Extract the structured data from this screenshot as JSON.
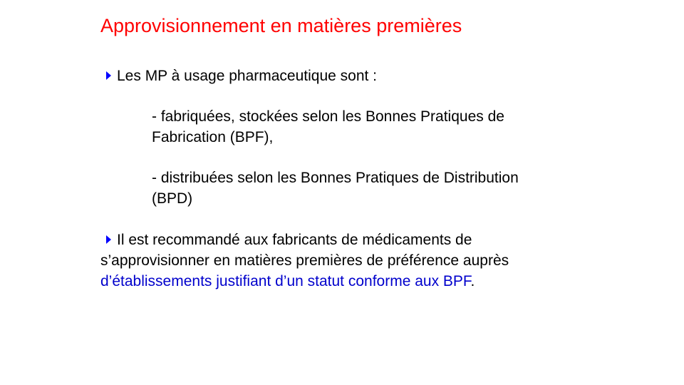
{
  "slide": {
    "title": "Approvisionnement en matières premières",
    "colors": {
      "title": "#ff0000",
      "bullet": "#0000ff",
      "highlight": "#0000cc",
      "text": "#000000"
    },
    "bullet_icon": "triangle-right-icon",
    "bullet1": {
      "text": "Les MP à usage pharmaceutique sont :"
    },
    "sub_items": [
      {
        "line1": "- fabriquées, stockées selon les Bonnes Pratiques de",
        "line2": "Fabrication (BPF),"
      },
      {
        "line1": "- distribuées selon les Bonnes Pratiques de Distribution",
        "line2": "(BPD)"
      }
    ],
    "bullet2": {
      "line1": "Il est recommandé aux fabricants de médicaments de",
      "line2": "s’approvisionner en matières premières de préférence auprès",
      "line3_highlight": "d’établissements justifiant d’un statut conforme aux BPF",
      "line3_end": "."
    }
  }
}
